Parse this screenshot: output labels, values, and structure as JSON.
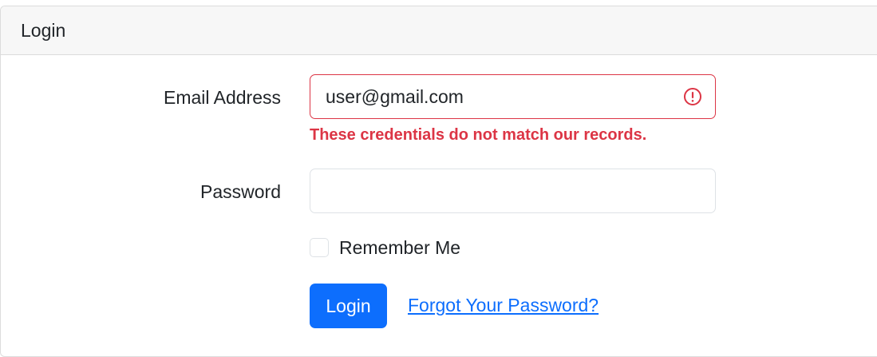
{
  "card": {
    "header_title": "Login"
  },
  "form": {
    "email": {
      "label": "Email Address",
      "value": "user@gmail.com",
      "error": "These credentials do not match our records.",
      "status_icon": "exclamation-circle-icon"
    },
    "password": {
      "label": "Password",
      "value": ""
    },
    "remember": {
      "label": "Remember Me",
      "checked": false
    },
    "submit_label": "Login",
    "forgot_link": "Forgot Your Password?"
  },
  "colors": {
    "primary": "#0d6efd",
    "danger": "#dc3545",
    "header_bg": "#f7f7f7",
    "border": "#dee2e6"
  }
}
